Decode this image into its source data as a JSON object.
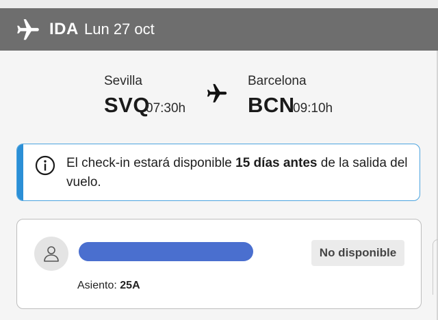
{
  "header": {
    "direction": "IDA",
    "date": "Lun 27 oct",
    "icon": "airplane-icon"
  },
  "route": {
    "origin": {
      "city": "Sevilla",
      "code": "SVQ",
      "time": "07:30h"
    },
    "destination": {
      "city": "Barcelona",
      "code": "BCN",
      "time": "09:10h"
    },
    "icon": "airplane-icon"
  },
  "notice": {
    "icon": "info-icon",
    "text_before": "El check-in estará disponible ",
    "text_bold": "15 días antes",
    "text_after": " de la salida del vuelo.",
    "accent_color": "#2b8fd6"
  },
  "passenger": {
    "name": "",
    "name_redacted": true,
    "status": "No disponible",
    "seat_label": "Asiento: ",
    "seat_value": "25A",
    "avatar_icon": "user-icon"
  },
  "colors": {
    "header_bg": "#6e6e6e",
    "redaction": "#4a6fcf"
  }
}
